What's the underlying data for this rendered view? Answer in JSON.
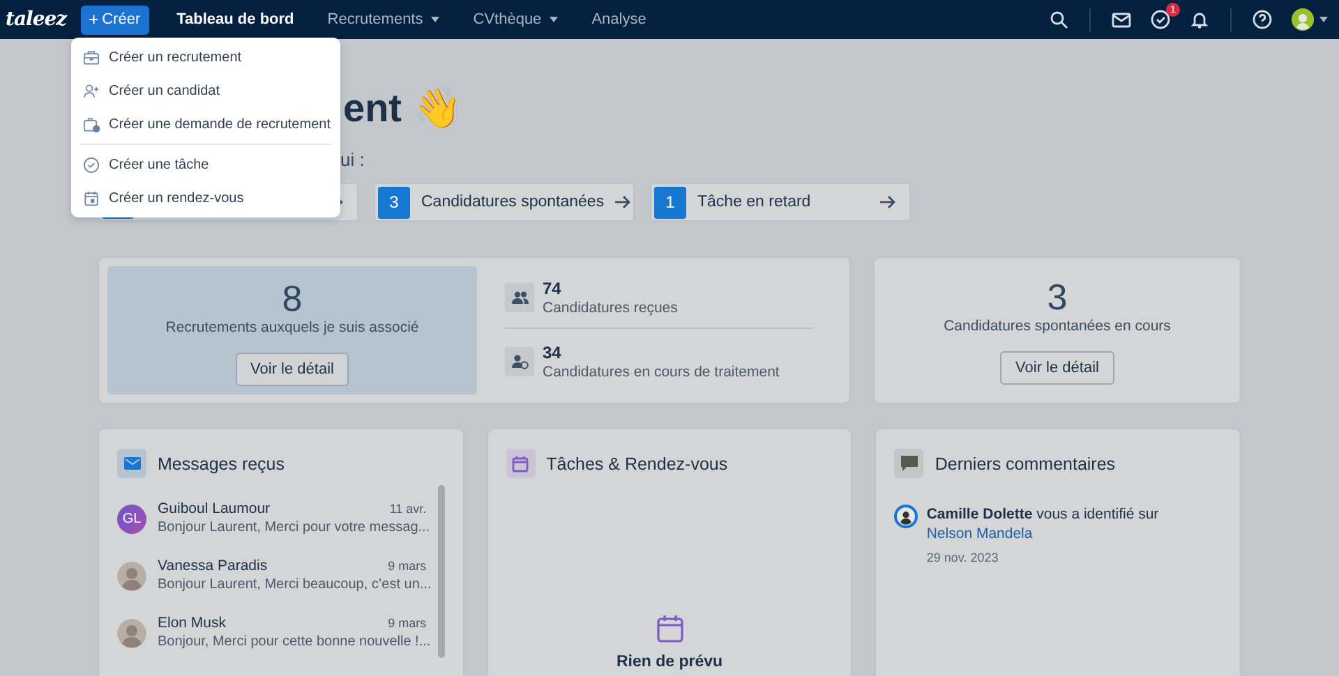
{
  "nav": {
    "logo": "taleez",
    "create_button": "Créer",
    "items": [
      {
        "label": "Tableau de bord",
        "selected": true,
        "dropdown": false
      },
      {
        "label": "Recrutements",
        "selected": false,
        "dropdown": true
      },
      {
        "label": "CVthèque",
        "selected": false,
        "dropdown": true
      },
      {
        "label": "Analyse",
        "selected": false,
        "dropdown": false
      }
    ],
    "tasks_badge": "1"
  },
  "create_menu": {
    "groups": [
      [
        {
          "label": "Créer un recrutement"
        },
        {
          "label": "Créer un candidat"
        },
        {
          "label": "Créer une demande de recrutement"
        }
      ],
      [
        {
          "label": "Créer une tâche"
        },
        {
          "label": "Créer un rendez-vous"
        }
      ]
    ]
  },
  "greeting": {
    "heading": "ent 👋",
    "subtitle": "ui :"
  },
  "quick_stats": [
    {
      "kind": "covered"
    },
    {
      "kind": "stat",
      "count": "3",
      "label": "Candidatures spontanées"
    },
    {
      "kind": "stat",
      "count": "1",
      "label": "Tâche en retard"
    }
  ],
  "summary": {
    "highlight": {
      "count": "8",
      "label": "Recrutements auxquels je suis associé",
      "button": "Voir le détail"
    },
    "metrics": [
      {
        "count": "74",
        "label": "Candidatures reçues"
      },
      {
        "count": "34",
        "label": "Candidatures en cours de traitement"
      }
    ],
    "side": {
      "count": "3",
      "label": "Candidatures spontanées en cours",
      "button": "Voir le détail"
    }
  },
  "messages": {
    "title": "Messages reçus",
    "items": [
      {
        "name": "Guiboul Laumour",
        "date": "11 avr.",
        "preview": "Bonjour Laurent, Merci pour votre messag...",
        "kind": "initials",
        "initials": "GL"
      },
      {
        "name": "Vanessa Paradis",
        "date": "9 mars",
        "preview": "Bonjour Laurent, Merci beaucoup, c’est un...",
        "kind": "photo"
      },
      {
        "name": "Elon Musk",
        "date": "9 mars",
        "preview": "Bonjour, Merci pour cette bonne nouvelle !...",
        "kind": "photo"
      }
    ]
  },
  "tasks": {
    "title": "Tâches & Rendez-vous",
    "empty_title": "Rien de prévu"
  },
  "comments": {
    "title": "Derniers commentaires",
    "items": [
      {
        "text": "**Camille Dolette** vous a identifié sur",
        "link": "Nelson Mandela",
        "date": "29 nov. 2023"
      }
    ]
  }
}
